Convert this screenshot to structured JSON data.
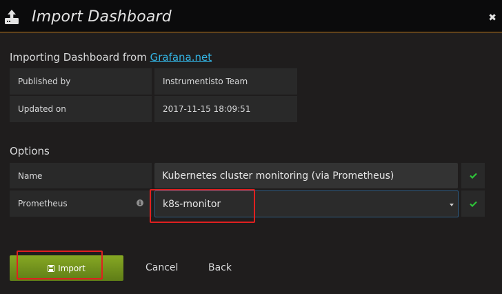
{
  "header": {
    "title": "Import Dashboard",
    "icon": "upload-icon",
    "close_label": "✖",
    "accent_color": "#c27a17"
  },
  "importing": {
    "prefix": "Importing Dashboard from ",
    "link_text": "Grafana.net"
  },
  "info": {
    "published_by_label": "Published by",
    "published_by_value": "Instrumentisto Team",
    "updated_on_label": "Updated on",
    "updated_on_value": "2017-11-15 18:09:51"
  },
  "options": {
    "title": "Options",
    "name_label": "Name",
    "name_value": "Kubernetes cluster monitoring (via Prometheus)",
    "prometheus_label": "Prometheus",
    "prometheus_value": "k8s-monitor",
    "info_icon": "info-icon",
    "check_icon": "check-icon",
    "check_color": "#2ec439"
  },
  "actions": {
    "import_label": "Import",
    "import_icon": "save-icon",
    "cancel_label": "Cancel",
    "back_label": "Back",
    "import_color": "#7a9d1f"
  },
  "annotation_color": "#e02020"
}
